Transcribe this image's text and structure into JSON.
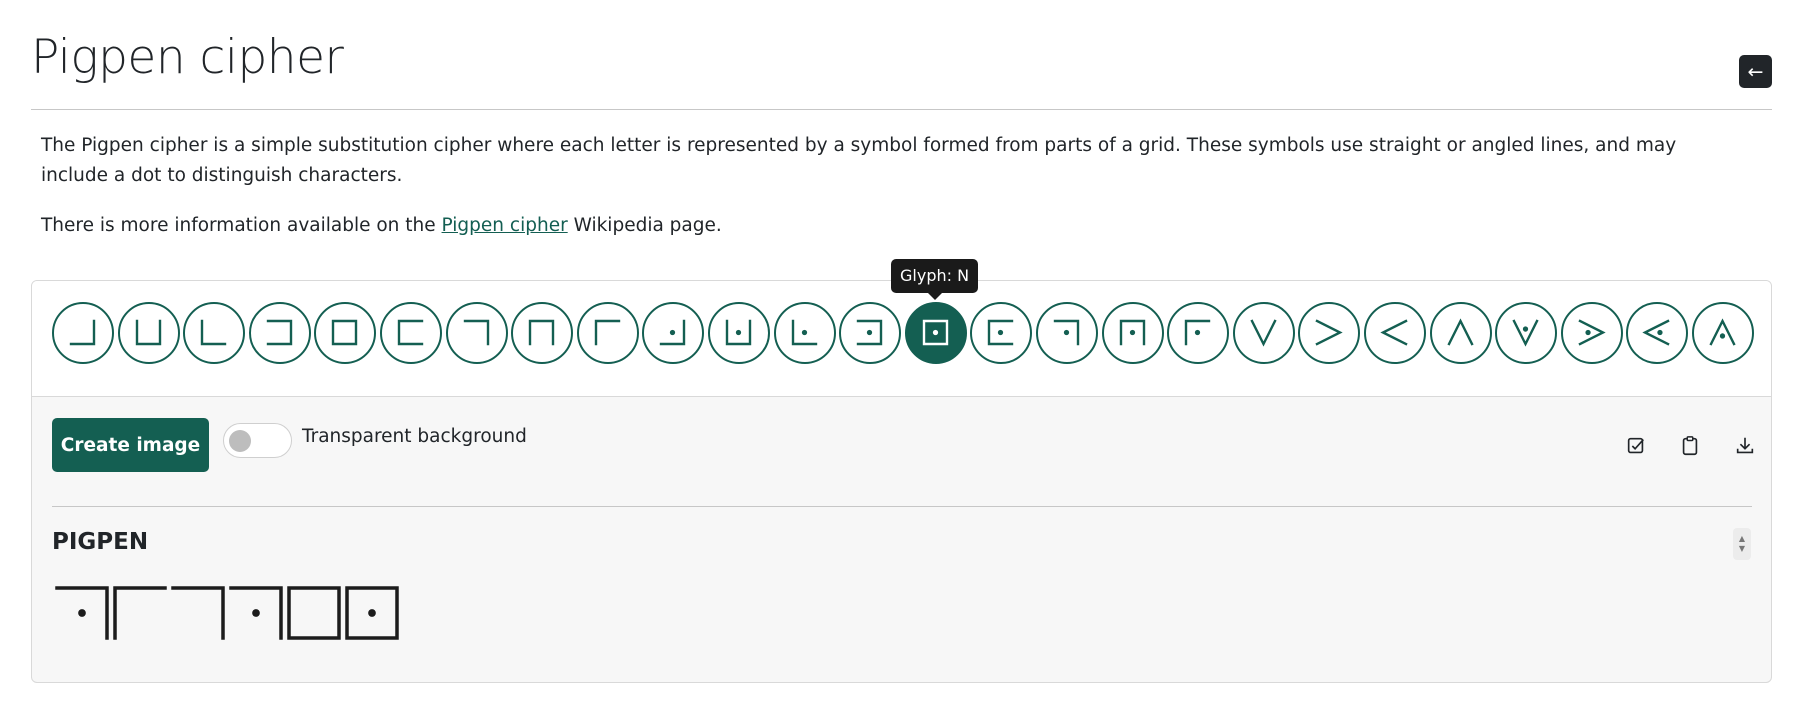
{
  "page": {
    "title": "Pigpen cipher",
    "back_icon": "left-arrow-icon",
    "description": "The Pigpen cipher is a simple substitution cipher where each letter is represented by a symbol formed from parts of a grid. These symbols use straight or angled lines, and may include a dot to distinguish characters.",
    "info_prefix": "There is more information available on the ",
    "info_link": "Pigpen cipher",
    "info_suffix": " Wikipedia page."
  },
  "glyphs": {
    "letters": [
      "A",
      "B",
      "C",
      "D",
      "E",
      "F",
      "G",
      "H",
      "I",
      "J",
      "K",
      "L",
      "M",
      "N",
      "O",
      "P",
      "Q",
      "R",
      "S",
      "T",
      "U",
      "V",
      "W",
      "X",
      "Y",
      "Z"
    ],
    "selected": "N",
    "tooltip": "Glyph: N"
  },
  "controls": {
    "create_label": "Create image",
    "toggle_label": "Transparent background",
    "toggle_on": false,
    "tools": [
      "check-square-icon",
      "clipboard-icon",
      "download-icon"
    ]
  },
  "output": {
    "label": "PIGPEN",
    "text": "PIGPEN"
  },
  "colors": {
    "accent": "#145f52",
    "link": "#135e52",
    "dark": "#212529",
    "glyph_ink": "#1c1c1c"
  }
}
